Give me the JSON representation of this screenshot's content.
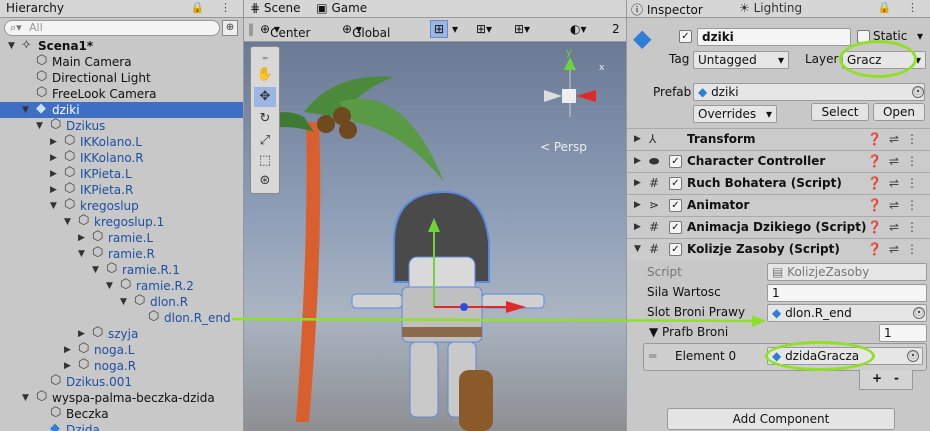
{
  "hierarchy": {
    "tab": "Hierarchy",
    "search_placeholder": "All",
    "items": [
      {
        "label": "Scena1*",
        "depth": 0,
        "icon": "unity-scene-icon",
        "arrow": "▼",
        "bold": true
      },
      {
        "label": "Main Camera",
        "depth": 1,
        "icon": "gameobject-icon",
        "arrow": ""
      },
      {
        "label": "Directional Light",
        "depth": 1,
        "icon": "gameobject-icon",
        "arrow": ""
      },
      {
        "label": "FreeLook Camera",
        "depth": 1,
        "icon": "gameobject-icon",
        "arrow": ""
      },
      {
        "label": "dziki",
        "depth": 1,
        "icon": "prefab-icon",
        "arrow": "▼",
        "selected": true
      },
      {
        "label": "Dzikus",
        "depth": 2,
        "icon": "gameobject-icon",
        "arrow": "▼",
        "prefab": true
      },
      {
        "label": "IKKolano.L",
        "depth": 3,
        "icon": "gameobject-icon",
        "arrow": "▶",
        "prefab": true
      },
      {
        "label": "IKKolano.R",
        "depth": 3,
        "icon": "gameobject-icon",
        "arrow": "▶",
        "prefab": true
      },
      {
        "label": "IKPieta.L",
        "depth": 3,
        "icon": "gameobject-icon",
        "arrow": "▶",
        "prefab": true
      },
      {
        "label": "IKPieta.R",
        "depth": 3,
        "icon": "gameobject-icon",
        "arrow": "▶",
        "prefab": true
      },
      {
        "label": "kregoslup",
        "depth": 3,
        "icon": "gameobject-icon",
        "arrow": "▼",
        "prefab": true
      },
      {
        "label": "kregoslup.1",
        "depth": 4,
        "icon": "gameobject-icon",
        "arrow": "▼",
        "prefab": true
      },
      {
        "label": "ramie.L",
        "depth": 5,
        "icon": "gameobject-icon",
        "arrow": "▶",
        "prefab": true
      },
      {
        "label": "ramie.R",
        "depth": 5,
        "icon": "gameobject-icon",
        "arrow": "▼",
        "prefab": true
      },
      {
        "label": "ramie.R.1",
        "depth": 6,
        "icon": "gameobject-icon",
        "arrow": "▼",
        "prefab": true
      },
      {
        "label": "ramie.R.2",
        "depth": 7,
        "icon": "gameobject-icon",
        "arrow": "▼",
        "prefab": true
      },
      {
        "label": "dlon.R",
        "depth": 8,
        "icon": "gameobject-icon",
        "arrow": "▼",
        "prefab": true
      },
      {
        "label": "dlon.R_end",
        "depth": 9,
        "icon": "gameobject-icon",
        "arrow": "",
        "prefab": true
      },
      {
        "label": "szyja",
        "depth": 5,
        "icon": "gameobject-icon",
        "arrow": "▶",
        "prefab": true
      },
      {
        "label": "noga.L",
        "depth": 4,
        "icon": "gameobject-icon",
        "arrow": "▶",
        "prefab": true
      },
      {
        "label": "noga.R",
        "depth": 4,
        "icon": "gameobject-icon",
        "arrow": "▶",
        "prefab": true
      },
      {
        "label": "Dzikus.001",
        "depth": 2,
        "icon": "gameobject-icon",
        "arrow": "",
        "prefab": true
      },
      {
        "label": "wyspa-palma-beczka-dzida",
        "depth": 1,
        "icon": "gameobject-icon",
        "arrow": "▼"
      },
      {
        "label": "Beczka",
        "depth": 2,
        "icon": "gameobject-icon",
        "arrow": ""
      },
      {
        "label": "Dzida",
        "depth": 2,
        "icon": "prefab-icon",
        "arrow": "",
        "prefab": true
      }
    ]
  },
  "scene": {
    "tab_scene": "Scene",
    "tab_game": "Game",
    "pivot": "Center",
    "space": "Global",
    "persp": "< Persp",
    "zoom": "2"
  },
  "inspector": {
    "tab": "Inspector",
    "tab_lighting": "Lighting",
    "object_name": "dziki",
    "static_label": "Static",
    "tag_label": "Tag",
    "tag_value": "Untagged",
    "layer_label": "Layer",
    "layer_value": "Gracz",
    "prefab_label": "Prefab",
    "prefab_value": "dziki",
    "overrides": "Overrides",
    "select": "Select",
    "open": "Open",
    "components": [
      {
        "name": "Transform",
        "icon": "transform-icon",
        "check": false
      },
      {
        "name": "Character Controller",
        "icon": "character-controller-icon",
        "check": true
      },
      {
        "name": "Ruch Bohatera (Script)",
        "icon": "script-icon",
        "check": true
      },
      {
        "name": "Animator",
        "icon": "animator-icon",
        "check": true
      },
      {
        "name": "Animacja Dzikiego (Script)",
        "icon": "script-icon",
        "check": true
      },
      {
        "name": "Kolizje Zasoby (Script)",
        "icon": "script-icon",
        "check": true,
        "expanded": true
      }
    ],
    "script_label": "Script",
    "script_value": "KolizjeZasoby",
    "sila_label": "Sila Wartosc",
    "sila_value": "1",
    "slot_label": "Slot Broni Prawy",
    "slot_value": "dlon.R_end",
    "prafb_label": "Prafb Broni",
    "prafb_value": "1",
    "element_label": "Element 0",
    "element_value": "dzidaGracza",
    "add_component": "Add Component"
  },
  "colors": {
    "accent": "#3f6fc4",
    "highlight": "#8fe026"
  }
}
